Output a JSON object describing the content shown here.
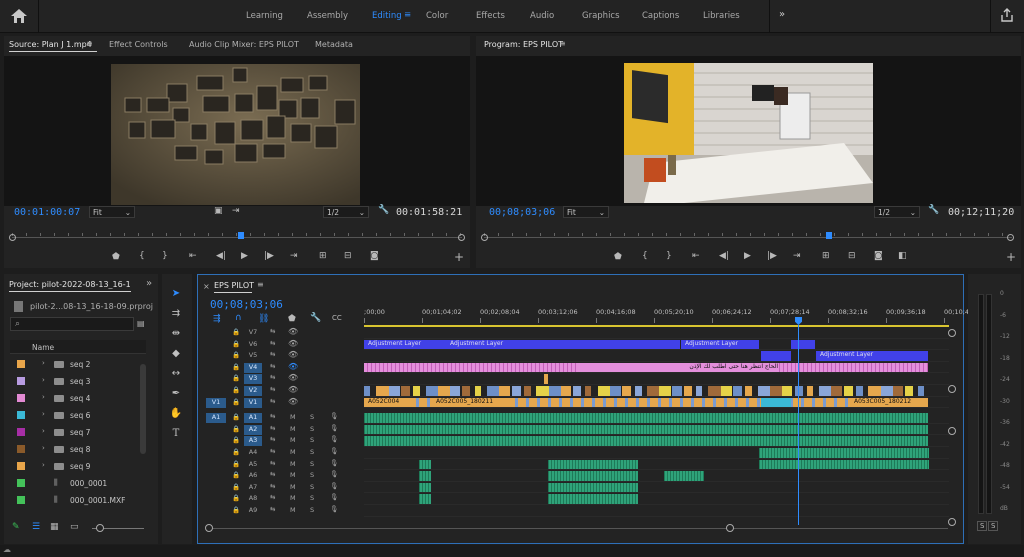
{
  "workspaces": [
    "Learning",
    "Assembly",
    "Editing",
    "Color",
    "Effects",
    "Audio",
    "Graphics",
    "Captions",
    "Libraries"
  ],
  "source_panel": {
    "tabs": [
      "Source: Plan J 1.mp4",
      "Effect Controls",
      "Audio Clip Mixer: EPS PILOT",
      "Metadata"
    ],
    "timecode_in": "00:01:00:07",
    "fit": "Fit",
    "resolution": "1/2",
    "duration": "00:01:58:21"
  },
  "program_panel": {
    "title": "Program: EPS PILOT",
    "timecode": "00;08;03;06",
    "fit": "Fit",
    "resolution": "1/2",
    "duration": "00;12;11;20"
  },
  "project_panel": {
    "title": "Project: pilot-2022-08-13_16-18-0",
    "file": "pilot-2...08-13_16-18-09.prproj",
    "column_name": "Name",
    "items": [
      {
        "label": "seq 2",
        "color": "#e8a54a"
      },
      {
        "label": "seq 3",
        "color": "#b79be0"
      },
      {
        "label": "seq 4",
        "color": "#e38ad3"
      },
      {
        "label": "seq 6",
        "color": "#3bb9d6"
      },
      {
        "label": "seq 7",
        "color": "#a72ea6"
      },
      {
        "label": "seq 8",
        "color": "#8a5a2a"
      },
      {
        "label": "seq 9",
        "color": "#e8a54a"
      },
      {
        "label": "000_0001",
        "color": "#44c25a"
      },
      {
        "label": "000_0001.MXF",
        "color": "#44c25a"
      }
    ]
  },
  "timeline": {
    "title": "EPS PILOT",
    "timecode": "00;08;03;06",
    "ruler": [
      ";00;00",
      "00;01;04;02",
      "00;02;08;04",
      "00;03;12;06",
      "00;04;16;08",
      "00;05;20;10",
      "00;06;24;12",
      "00;07;28;14",
      "00;08;32;16",
      "00;09;36;18",
      "00;10;40;"
    ],
    "video_tracks": [
      "V7",
      "V6",
      "V5",
      "V4",
      "V3",
      "V2",
      "V1"
    ],
    "audio_tracks": [
      "A1",
      "A2",
      "A3",
      "A4",
      "A5",
      "A6",
      "A7",
      "A8",
      "A9"
    ],
    "src_v1": "V1",
    "src_a1": "A1",
    "clips": {
      "adj1": "Adjustment Layer",
      "adj2": "Adjustment Layer",
      "adj3": "Adjustment Layer",
      "adj4": "Adjustment Layer",
      "arabic": "الحاج انتظر هنا حتى اطلب لك الإذن",
      "v1a": "A052C004",
      "v1b": "A052C005_180211",
      "v1c": "A053C005_180212"
    },
    "ms": {
      "m": "M",
      "s": "S"
    }
  },
  "meter": {
    "scale": [
      "0",
      "-6",
      "-12",
      "-18",
      "-24",
      "-30",
      "-36",
      "-42",
      "-48",
      "-54",
      "dB"
    ],
    "solo": [
      "S",
      "S"
    ]
  },
  "colors": {
    "accent": "#2e8cff",
    "adjustment": "#4141e8",
    "arabic_clip": "#e48fdc",
    "video_clip": "#e5a74d",
    "audio_clip": "#2fa37a"
  }
}
